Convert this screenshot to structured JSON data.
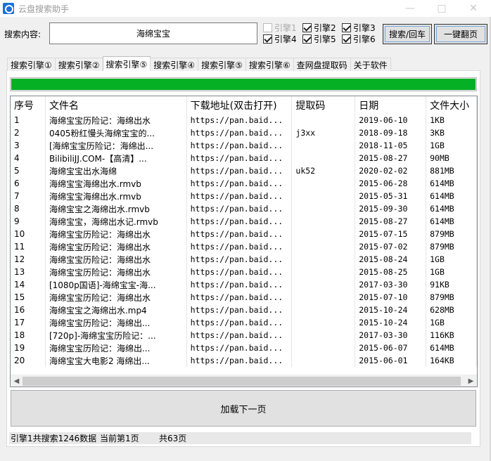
{
  "window": {
    "title": "云盘搜索助手",
    "controls": {
      "minimize": "—",
      "maximize": "□",
      "close": "✕"
    }
  },
  "search": {
    "label": "搜索内容:",
    "value": "海绵宝宝"
  },
  "engines": [
    {
      "label": "引擎1",
      "checked": false
    },
    {
      "label": "引擎2",
      "checked": true
    },
    {
      "label": "引擎3",
      "checked": true
    },
    {
      "label": "引擎4",
      "checked": true
    },
    {
      "label": "引擎5",
      "checked": true
    },
    {
      "label": "引擎6",
      "checked": true
    }
  ],
  "buttons": {
    "search": "搜索/回车",
    "flip_all": "一键翻页",
    "load_next": "加载下一页"
  },
  "tabs": [
    {
      "label": "搜索引擎①",
      "active": false
    },
    {
      "label": "搜索引擎②",
      "active": false
    },
    {
      "label": "搜索引擎⑤",
      "active": true
    },
    {
      "label": "搜索引擎④",
      "active": false
    },
    {
      "label": "搜索引擎⑤",
      "active": false
    },
    {
      "label": "搜索引擎⑥",
      "active": false
    },
    {
      "label": "查网盘提取码",
      "active": false
    },
    {
      "label": "关于软件",
      "active": false
    }
  ],
  "progress": {
    "value": 1.0,
    "color": "#06b025"
  },
  "table": {
    "columns": [
      "序号",
      "文件名",
      "下载地址(双击打开)",
      "提取码",
      "日期",
      "文件大小"
    ],
    "rows": [
      [
        "1",
        "海绵宝宝历险记：海绵出水",
        "https://pan.baid...",
        "",
        "2019-06-10",
        "1KB"
      ],
      [
        "2",
        "0405粉红慢头海绵宝宝的...",
        "https://pan.baid...",
        "j3xx",
        "2018-09-18",
        "3KB"
      ],
      [
        "3",
        "[海绵宝宝历险记：海绵出...",
        "https://pan.baid...",
        "",
        "2018-11-05",
        "1GB"
      ],
      [
        "4",
        "BilibiliJJ.COM-【高清】...",
        "https://pan.baid...",
        "",
        "2015-08-27",
        "90MB"
      ],
      [
        "5",
        "海绵宝宝出水海绵",
        "https://pan.baid...",
        "uk52",
        "2020-02-02",
        "881MB"
      ],
      [
        "6",
        "海绵宝宝海绵出水.rmvb",
        "https://pan.baid...",
        "",
        "2015-06-28",
        "614MB"
      ],
      [
        "7",
        "海绵宝宝海绵出水.rmvb",
        "https://pan.baid...",
        "",
        "2015-05-31",
        "614MB"
      ],
      [
        "8",
        "海绵宝宝之海绵出水.rmvb",
        "https://pan.baid...",
        "",
        "2015-09-30",
        "614MB"
      ],
      [
        "9",
        "海绵宝宝，海绵出水记.rmvb",
        "https://pan.baid...",
        "",
        "2015-08-27",
        "614MB"
      ],
      [
        "10",
        "海绵宝宝历险记：海绵出水",
        "https://pan.baid...",
        "",
        "2015-07-15",
        "879MB"
      ],
      [
        "11",
        "海绵宝宝历险记：海绵出水",
        "https://pan.baid...",
        "",
        "2015-07-02",
        "879MB"
      ],
      [
        "12",
        "海绵宝宝历险记：海绵出水",
        "https://pan.baid...",
        "",
        "2015-08-24",
        "1GB"
      ],
      [
        "13",
        "海绵宝宝历险记：海绵出水",
        "https://pan.baid...",
        "",
        "2015-08-25",
        "1GB"
      ],
      [
        "14",
        "[1080p国语]-海绵宝宝-海...",
        "https://pan.baid...",
        "",
        "2017-03-30",
        "91KB"
      ],
      [
        "15",
        "海绵宝宝历险记：海绵出水",
        "https://pan.baid...",
        "",
        "2015-07-10",
        "879MB"
      ],
      [
        "16",
        "海绵宝宝之海绵出水.mp4",
        "https://pan.baid...",
        "",
        "2015-10-24",
        "628MB"
      ],
      [
        "17",
        "海绵宝宝历险记：海绵出...",
        "https://pan.baid...",
        "",
        "2015-10-24",
        "1GB"
      ],
      [
        "18",
        "[720p]-海绵宝宝历险记：...",
        "https://pan.baid...",
        "",
        "2017-03-30",
        "116KB"
      ],
      [
        "19",
        "海绵宝宝历险记：海绵出...",
        "https://pan.baid...",
        "",
        "2015-06-07",
        "614MB"
      ],
      [
        "20",
        "海绵宝宝大电影2 海绵出...",
        "https://pan.baid...",
        "",
        "2015-06-01",
        "164KB"
      ]
    ]
  },
  "scrollbar": {
    "left_arrow": "◀",
    "right_arrow": "▶"
  },
  "status": {
    "result_count": "引擎1共搜索1246数据",
    "current_page": "当前第1页",
    "total_pages": "共63页"
  }
}
